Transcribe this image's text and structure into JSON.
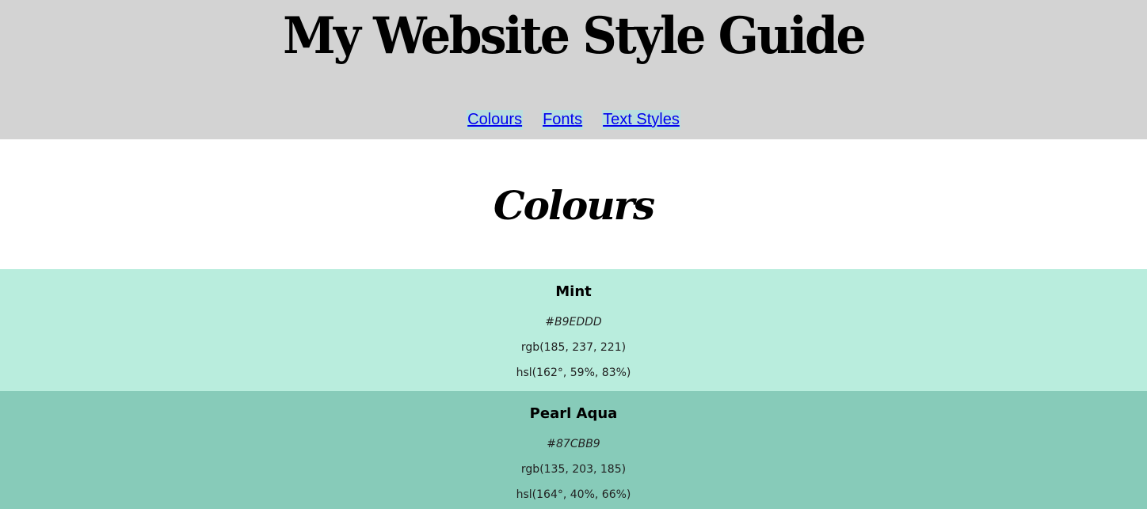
{
  "header": {
    "title": "My Website Style Guide",
    "background": "#d3d3d3",
    "nav": [
      {
        "label": "Colours"
      },
      {
        "label": "Fonts"
      },
      {
        "label": "Text Styles"
      }
    ],
    "nav_link_color": "#0000ee",
    "nav_highlight": "#b9dede"
  },
  "colours_section": {
    "title": "Colours",
    "swatches": [
      {
        "name": "Mint",
        "hex": "#B9EDDD",
        "rgb": "rgb(185, 237, 221)",
        "hsl": "hsl(162°, 59%, 83%)",
        "color": "#B9EDDD"
      },
      {
        "name": "Pearl Aqua",
        "hex": "#87CBB9",
        "rgb": "rgb(135, 203, 185)",
        "hsl": "hsl(164°, 40%, 66%)",
        "color": "#87CBB9"
      }
    ]
  }
}
